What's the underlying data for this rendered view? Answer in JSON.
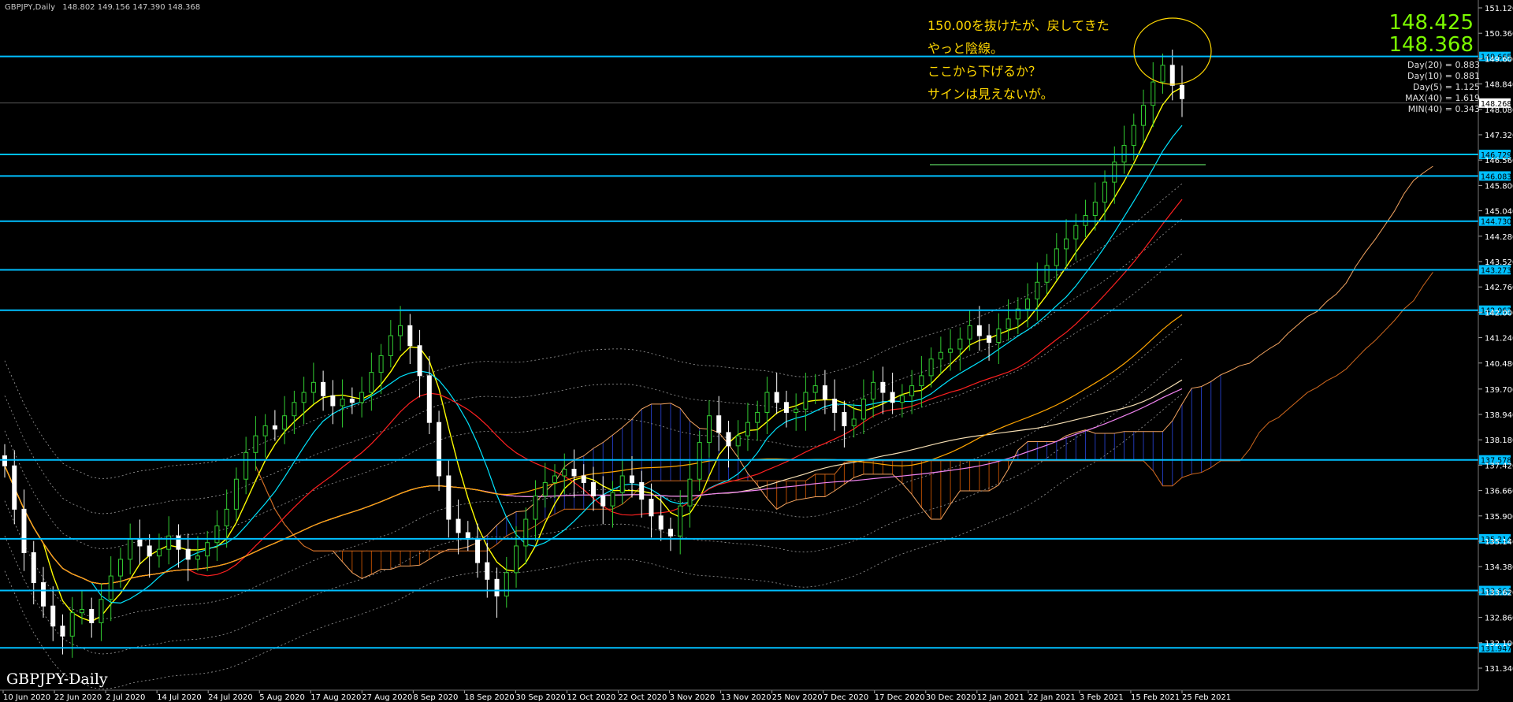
{
  "header": {
    "symbol": "GBPJPY,Daily",
    "ohlc": "148.802 149.156 147.390 148.368"
  },
  "watermark": "GBPJPY-Daily",
  "price_display": {
    "bid": "148.425",
    "last": "148.368"
  },
  "stats": [
    "Day(20) = 0.883",
    "Day(10) = 0.881",
    "Day(5) = 1.125",
    "MAX(40) = 1.619",
    "MIN(40) = 0.343"
  ],
  "annotation_lines": [
    "150.00を抜けたが、戻してきた",
    "やっと陰線。",
    "ここから下げるか？",
    "サインは見えないが。"
  ],
  "colors": {
    "background": "#000000",
    "bull_candle": "#32cd32",
    "bear_candle": "#ffffff",
    "hline": "#00bfff",
    "cloud_bear": "#ff6a00",
    "cloud_bull": "#3050ff",
    "annotation": "#ffd700",
    "axis_text": "#ffffff"
  },
  "chart_data": {
    "type": "candlestick",
    "symbol": "GBPJPY",
    "timeframe": "Daily",
    "ylim": [
      131.34,
      151.12
    ],
    "y_ticks": [
      "151.120",
      "150.360",
      "149.600",
      "148.840",
      "148.080",
      "147.320",
      "146.560",
      "145.800",
      "145.040",
      "144.280",
      "143.520",
      "142.760",
      "142.000",
      "141.240",
      "140.480",
      "139.700",
      "138.940",
      "138.180",
      "137.420",
      "136.660",
      "135.900",
      "135.140",
      "134.380",
      "133.620",
      "132.860",
      "132.100",
      "131.340"
    ],
    "x_labels": [
      "10 Jun 2020",
      "22 Jun 2020",
      "2 Jul 2020",
      "14 Jul 2020",
      "24 Jul 2020",
      "5 Aug 2020",
      "17 Aug 2020",
      "27 Aug 2020",
      "8 Sep 2020",
      "18 Sep 2020",
      "30 Sep 2020",
      "12 Oct 2020",
      "22 Oct 2020",
      "3 Nov 2020",
      "13 Nov 2020",
      "25 Nov 2020",
      "7 Dec 2020",
      "17 Dec 2020",
      "30 Dec 2020",
      "12 Jan 2021",
      "22 Jan 2021",
      "3 Feb 2021",
      "15 Feb 2021",
      "25 Feb 2021"
    ],
    "horizontal_levels": [
      "149.665",
      "146.729",
      "146.083",
      "144.730",
      "143.273",
      "142.063",
      "137.578",
      "135.214",
      "133.664",
      "131.947"
    ],
    "current_price_label": "148.268",
    "series_close": [
      137.4,
      136.1,
      134.8,
      133.9,
      133.2,
      132.6,
      132.3,
      133.0,
      133.1,
      132.7,
      133.4,
      134.1,
      134.6,
      135.2,
      135.0,
      134.7,
      134.9,
      135.3,
      134.9,
      134.6,
      134.7,
      135.1,
      135.6,
      136.1,
      137.0,
      137.8,
      138.3,
      138.6,
      138.5,
      138.9,
      139.3,
      139.6,
      139.9,
      139.5,
      139.2,
      139.4,
      139.3,
      139.6,
      140.2,
      140.7,
      141.3,
      141.6,
      141.0,
      140.1,
      138.7,
      137.1,
      135.8,
      135.4,
      135.2,
      134.5,
      134.0,
      133.5,
      134.2,
      135.0,
      135.8,
      136.5,
      136.9,
      137.1,
      137.3,
      137.1,
      136.9,
      136.5,
      136.2,
      136.6,
      137.1,
      136.9,
      136.4,
      135.9,
      135.5,
      135.3,
      136.2,
      137.0,
      138.1,
      138.9,
      138.4,
      138.0,
      138.3,
      138.7,
      139.0,
      139.6,
      139.3,
      139.0,
      139.1,
      139.6,
      139.8,
      139.4,
      139.0,
      138.6,
      138.8,
      139.4,
      139.9,
      139.6,
      139.3,
      139.5,
      139.8,
      140.1,
      140.6,
      140.8,
      140.9,
      141.2,
      141.6,
      141.3,
      141.1,
      141.5,
      141.8,
      142.1,
      142.4,
      142.9,
      143.4,
      143.9,
      144.2,
      144.6,
      144.9,
      145.3,
      145.9,
      146.5,
      147.0,
      147.6,
      148.2,
      148.9,
      149.4,
      148.8,
      148.4
    ],
    "moving_averages": [
      {
        "color": "#ffff00"
      },
      {
        "color": "#00e5ff"
      },
      {
        "color": "#ff2020"
      },
      {
        "color": "#f5deb3"
      },
      {
        "color": "#ee82ee"
      },
      {
        "color": "#ffa500"
      }
    ]
  }
}
